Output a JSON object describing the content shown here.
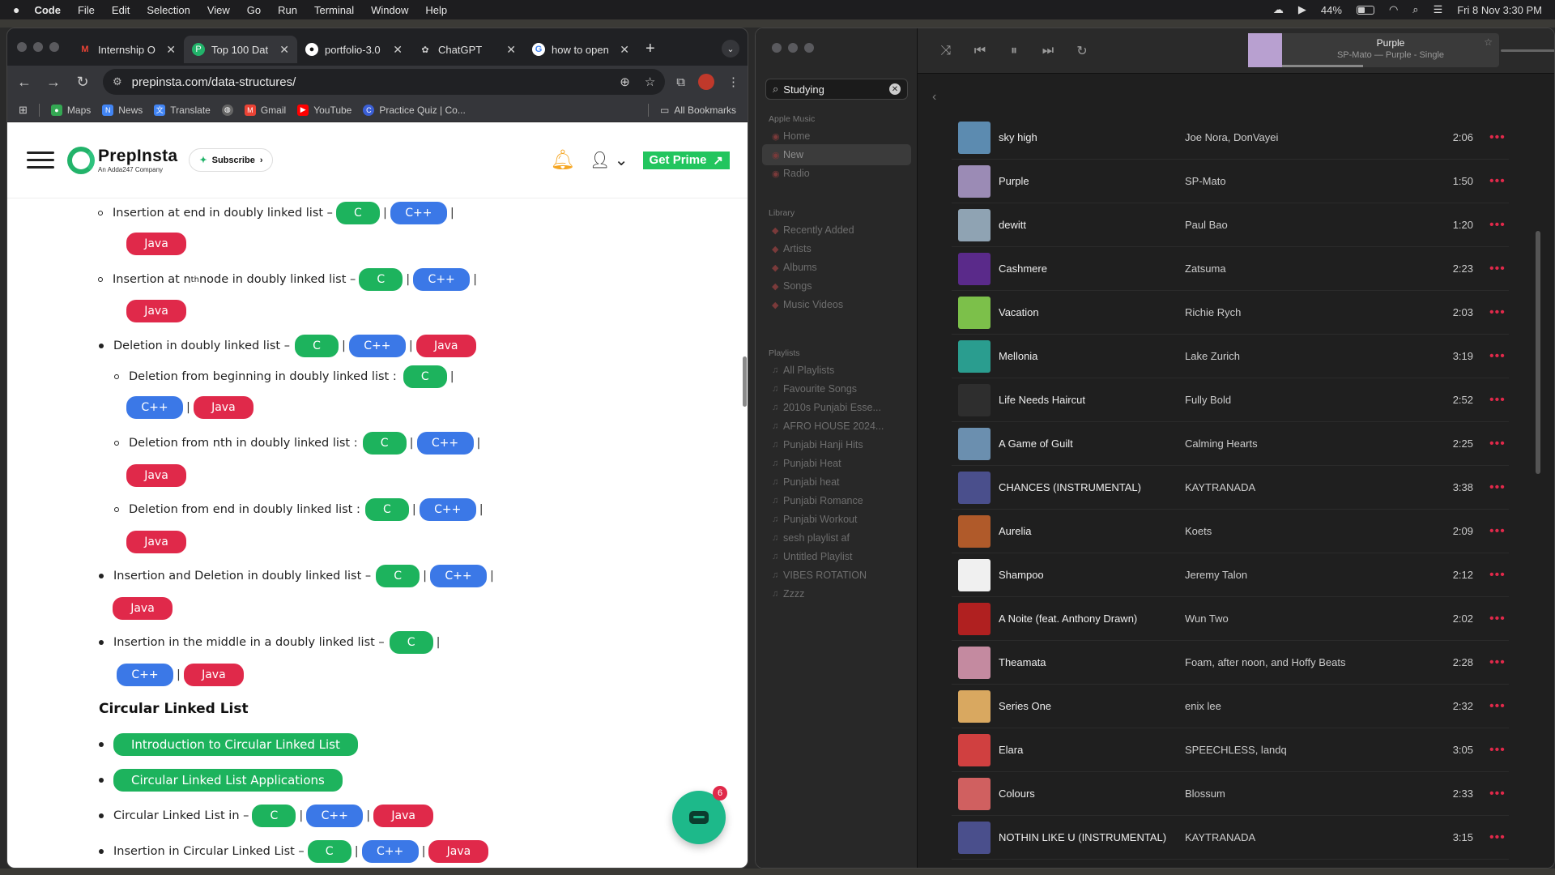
{
  "menubar": {
    "items": [
      "Code",
      "File",
      "Edit",
      "Selection",
      "View",
      "Go",
      "Run",
      "Terminal",
      "Window",
      "Help"
    ],
    "battery": "44%",
    "datetime": "Fri 8 Nov  3:30 PM"
  },
  "chrome": {
    "tabs": [
      {
        "title": "Internship O",
        "icon": "gmail-icon",
        "color": "#ea4335"
      },
      {
        "title": "Top 100 Dat",
        "icon": "prepinsta-icon",
        "color": "#22b36a"
      },
      {
        "title": "portfolio-3.0",
        "icon": "github-icon",
        "color": "#ffffff"
      },
      {
        "title": "ChatGPT",
        "icon": "chatgpt-icon",
        "color": "#cccccc"
      },
      {
        "title": "how to open",
        "icon": "google-icon",
        "color": "#4285f4"
      }
    ],
    "url": "prepinsta.com/data-structures/",
    "bookmarks": [
      "Maps",
      "News",
      "Translate",
      "",
      "Gmail",
      "YouTube",
      "Practice Quiz | Co..."
    ],
    "all_bookmarks": "All Bookmarks"
  },
  "site": {
    "brand": "PrepInsta",
    "brand_sub": "An Adda247 Company",
    "subscribe": "Subscribe",
    "get_prime": "Get Prime"
  },
  "content": {
    "lang": {
      "c": "C",
      "cpp": "C++",
      "java": "Java"
    },
    "sep": "|",
    "items": {
      "ins_end": "Insertion at end in doubly linked list –",
      "ins_nth_a": "Insertion at n",
      "ins_nth_sup": "th",
      "ins_nth_b": " node in doubly linked list –",
      "del_dll": "Deletion in doubly linked list  –",
      "del_begin": "Deletion from beginning in doubly linked list :",
      "del_nth": "Deletion from nth in doubly linked list :",
      "del_end": "Deletion from end in doubly linked list :",
      "ins_del": "Insertion and Deletion  in doubly linked list  –",
      "ins_mid": "Insertion in the middle in a doubly linked list  –",
      "section_cll": "Circular Linked List",
      "intro_cll": "Introduction to Circular Linked List",
      "cll_apps": "Circular Linked List Applications",
      "cll_in": "Circular Linked List in –",
      "ins_cll": "Insertion in Circular Linked List –"
    },
    "chat_badge": "6"
  },
  "music": {
    "search": "Studying",
    "now_playing": {
      "title": "Purple",
      "subtitle": "SP-Mato — Purple - Single"
    },
    "sections": {
      "apple_music": "Apple Music",
      "library": "Library",
      "playlists": "Playlists"
    },
    "apple_music_items": [
      "Home",
      "New",
      "Radio"
    ],
    "library_items": [
      "Recently Added",
      "Artists",
      "Albums",
      "Songs",
      "Music Videos"
    ],
    "playlists": [
      "All Playlists",
      "Favourite Songs",
      "2010s Punjabi Esse...",
      "AFRO HOUSE 2024...",
      "Punjabi Hanji Hits",
      "Punjabi Heat",
      "Punjabi heat",
      "Punjabi Romance",
      "Punjabi Workout",
      "sesh playlist af",
      "Untitled Playlist",
      "VIBES ROTATION",
      "Zzzz"
    ],
    "songs": [
      {
        "title": "sky high",
        "artist": "Joe Nora, DonVayei",
        "duration": "2:06",
        "color": "#5c8bb0"
      },
      {
        "title": "Purple",
        "artist": "SP-Mato",
        "duration": "1:50",
        "color": "#9b8bb5"
      },
      {
        "title": "dewitt",
        "artist": "Paul Bao",
        "duration": "1:20",
        "color": "#8fa3b3"
      },
      {
        "title": "Cashmere",
        "artist": "Zatsuma",
        "duration": "2:23",
        "color": "#5a2a8a"
      },
      {
        "title": "Vacation",
        "artist": "Richie Rych",
        "duration": "2:03",
        "color": "#7cc04a"
      },
      {
        "title": "Mellonia",
        "artist": "Lake Zurich",
        "duration": "3:19",
        "color": "#2a9d8f"
      },
      {
        "title": "Life Needs Haircut",
        "artist": "Fully Bold",
        "duration": "2:52",
        "color": "#2e2e2e"
      },
      {
        "title": "A Game of Guilt",
        "artist": "Calming Hearts",
        "duration": "2:25",
        "color": "#6b8faf"
      },
      {
        "title": "CHANCES (INSTRUMENTAL)",
        "artist": "KAYTRANADA",
        "duration": "3:38",
        "color": "#4a4f8c"
      },
      {
        "title": "Aurelia",
        "artist": "Koets",
        "duration": "2:09",
        "color": "#b05a2a"
      },
      {
        "title": "Shampoo",
        "artist": "Jeremy Talon",
        "duration": "2:12",
        "color": "#f0f0f0"
      },
      {
        "title": "A Noite (feat. Anthony Drawn)",
        "artist": "Wun Two",
        "duration": "2:02",
        "color": "#b02020"
      },
      {
        "title": "Theamata",
        "artist": "Foam, after noon, and Hoffy Beats",
        "duration": "2:28",
        "color": "#c48aa0"
      },
      {
        "title": "Series One",
        "artist": "enix lee",
        "duration": "2:32",
        "color": "#d9a860"
      },
      {
        "title": "Elara",
        "artist": "SPEECHLESS, landq",
        "duration": "3:05",
        "color": "#d04040"
      },
      {
        "title": "Colours",
        "artist": "Blossum",
        "duration": "2:33",
        "color": "#d06060"
      },
      {
        "title": "NOTHIN LIKE U (INSTRUMENTAL)",
        "artist": "KAYTRANADA",
        "duration": "3:15",
        "color": "#4a4f8c"
      }
    ]
  }
}
